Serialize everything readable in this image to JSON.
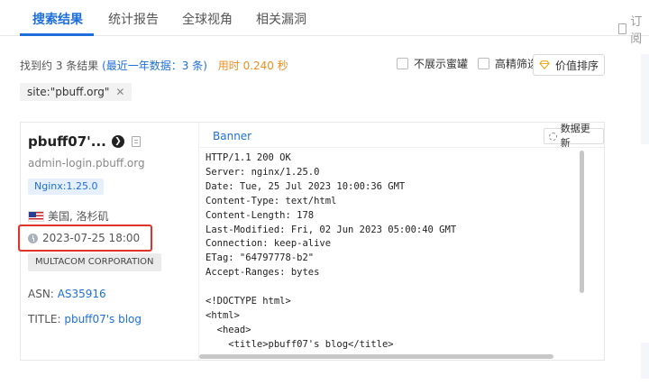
{
  "tabs": [
    {
      "label": "搜索结果",
      "active": true
    },
    {
      "label": "统计报告",
      "active": false
    },
    {
      "label": "全球视角",
      "active": false
    },
    {
      "label": "相关漏洞",
      "active": false
    }
  ],
  "subscribe_label": "订阅",
  "summary": {
    "prefix": "找到约 3 条结果",
    "recent": "(最近一年数据：3 条)",
    "time": "用时 0.240 秒"
  },
  "filters": {
    "hide_honeypot": "不展示蜜罐",
    "precise_filter": "高精筛选",
    "value_sort": "价值排序"
  },
  "query_chip": "site:\"pbuff.org\"",
  "result": {
    "host_title": "pbuff07'...",
    "domain": "admin-login.pbuff.org",
    "server_tag": "Nginx:1.25.0",
    "location": "美国, 洛杉矶",
    "timestamp": "2023-07-25 18:00",
    "org": "MULTACOM CORPORATION",
    "asn_label": "ASN:",
    "asn_value": "AS35916",
    "title_label": "TITLE:",
    "title_value": "pbuff07's blog",
    "banner_label": "Banner",
    "update_label": "数据更新",
    "banner_lines": "HTTP/1.1 200 OK\nServer: nginx/1.25.0\nDate: Tue, 25 Jul 2023 10:00:36 GMT\nContent-Type: text/html\nContent-Length: 178\nLast-Modified: Fri, 02 Jun 2023 05:00:40 GMT\nConnection: keep-alive\nETag: \"64797778-b2\"\nAccept-Ranges: bytes\n\n<!DOCTYPE html>\n<html>\n  <head>\n    <title>pbuff07's blog</title>"
  },
  "colors": {
    "accent": "#1e6fd9",
    "highlight_box": "#e0342b",
    "time_text": "#f08c1c"
  }
}
